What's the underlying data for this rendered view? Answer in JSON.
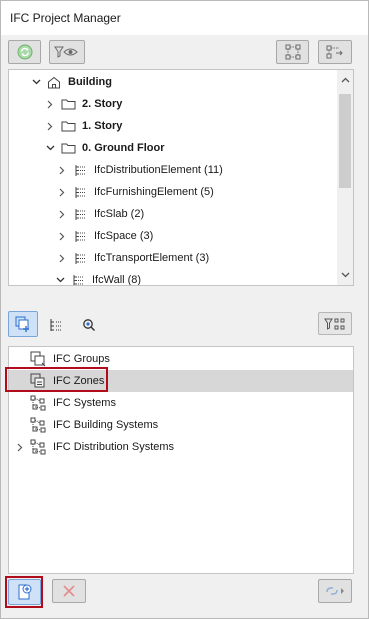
{
  "window": {
    "title": "IFC Project Manager"
  },
  "colors": {
    "accent_blue": "#2e6fd1",
    "highlight_red": "#b00c1c",
    "selection_gray": "#d7d7d7",
    "refresh_green": "#6bb36b"
  },
  "toolbar_top": {
    "buttons": [
      {
        "name": "refresh-button",
        "icon": "refresh-icon"
      },
      {
        "name": "filter-view-button",
        "icon": "filter-eye-icon"
      },
      {
        "name": "tree-structure-button",
        "icon": "tree-nodes-icon"
      },
      {
        "name": "export-structure-button",
        "icon": "export-icon"
      }
    ]
  },
  "project_tree": {
    "items": [
      {
        "label": "Building",
        "bold": true,
        "expanded": true,
        "icon": "building-icon"
      },
      {
        "label": "2. Story",
        "bold": true,
        "expanded": false,
        "icon": "folder-icon"
      },
      {
        "label": "1. Story",
        "bold": true,
        "expanded": false,
        "icon": "folder-icon"
      },
      {
        "label": "0. Ground Floor",
        "bold": true,
        "expanded": true,
        "icon": "folder-icon"
      },
      {
        "label": "IfcDistributionElement (11)",
        "bold": false,
        "expanded": false,
        "icon": "element-list-icon"
      },
      {
        "label": "IfcFurnishingElement (5)",
        "bold": false,
        "expanded": false,
        "icon": "element-list-icon"
      },
      {
        "label": "IfcSlab (2)",
        "bold": false,
        "expanded": false,
        "icon": "element-list-icon"
      },
      {
        "label": "IfcSpace (3)",
        "bold": false,
        "expanded": false,
        "icon": "element-list-icon"
      },
      {
        "label": "IfcTransportElement (3)",
        "bold": false,
        "expanded": false,
        "icon": "element-list-icon"
      },
      {
        "label": "IfcWall (8)",
        "bold": false,
        "expanded": true,
        "icon": "element-list-icon"
      }
    ]
  },
  "toolbar_mid": {
    "tabs": [
      {
        "name": "tab-groups",
        "icon": "group-add-icon",
        "active": true
      },
      {
        "name": "tab-hierarchy",
        "icon": "hierarchy-icon",
        "active": false
      },
      {
        "name": "tab-search",
        "icon": "search-icon",
        "active": false
      }
    ],
    "filter_button": {
      "icon": "filter-nodes-icon"
    }
  },
  "groups_tree": {
    "items": [
      {
        "label": "IFC Groups",
        "icon": "ifc-group-icon",
        "selected": false,
        "expandable": false
      },
      {
        "label": "IFC Zones",
        "icon": "ifc-zone-icon",
        "selected": true,
        "expandable": false,
        "highlighted": true
      },
      {
        "label": "IFC Systems",
        "icon": "ifc-system-icon",
        "selected": false,
        "expandable": false
      },
      {
        "label": "IFC Building Systems",
        "icon": "ifc-system-icon",
        "selected": false,
        "expandable": false
      },
      {
        "label": "IFC Distribution Systems",
        "icon": "ifc-system-icon",
        "selected": false,
        "expandable": true
      }
    ]
  },
  "toolbar_bottom": {
    "buttons": [
      {
        "name": "new-group-button",
        "icon": "new-item-icon",
        "highlighted": true
      },
      {
        "name": "delete-button",
        "icon": "delete-x-icon"
      },
      {
        "name": "link-menu-button",
        "icon": "link-icon"
      }
    ]
  }
}
